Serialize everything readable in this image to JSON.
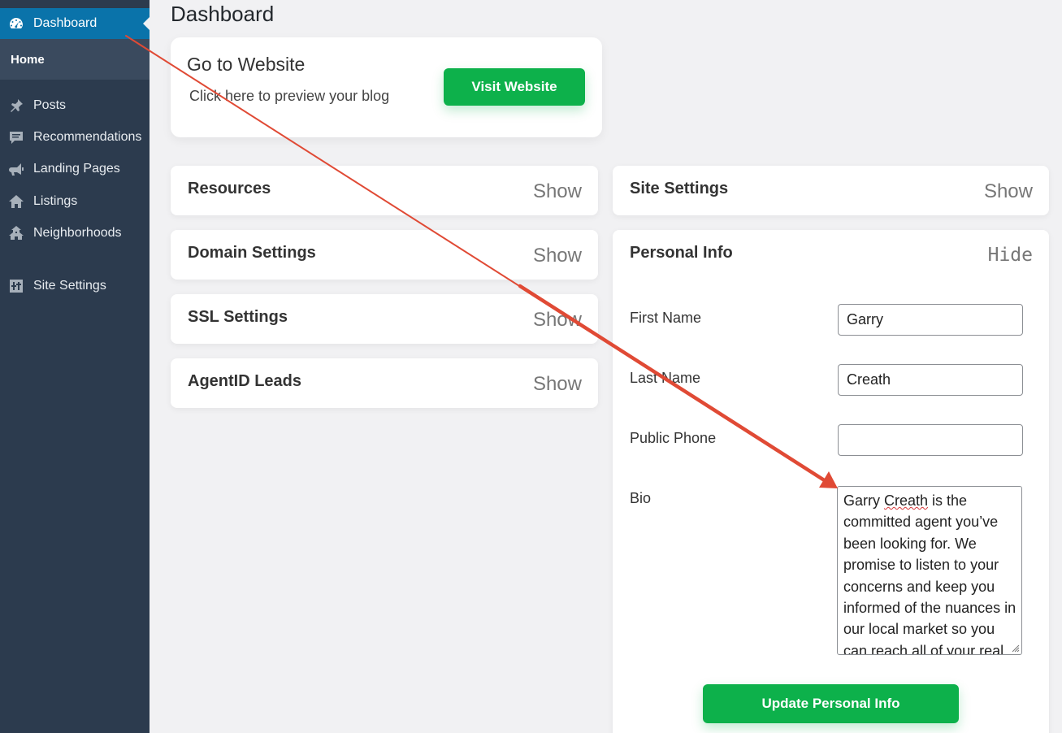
{
  "sidebar": {
    "active": {
      "label": "Dashboard",
      "icon": "dashboard-gauge-icon"
    },
    "submenu": {
      "label": "Home"
    },
    "items": [
      {
        "label": "Posts",
        "icon": "pin-icon"
      },
      {
        "label": "Recommendations",
        "icon": "comment-icon"
      },
      {
        "label": "Landing Pages",
        "icon": "megaphone-icon"
      },
      {
        "label": "Listings",
        "icon": "home-icon"
      },
      {
        "label": "Neighborhoods",
        "icon": "neighborhood-icon"
      },
      {
        "label": "Site Settings",
        "icon": "settings-sliders-icon"
      }
    ]
  },
  "page": {
    "title": "Dashboard"
  },
  "goto": {
    "title": "Go to Website",
    "description": "Click here to preview your blog",
    "button": "Visit Website"
  },
  "sections": {
    "resources": {
      "title": "Resources",
      "toggle": "Show"
    },
    "domain": {
      "title": "Domain Settings",
      "toggle": "Show"
    },
    "ssl": {
      "title": "SSL Settings",
      "toggle": "Show"
    },
    "agentid": {
      "title": "AgentID Leads",
      "toggle": "Show"
    },
    "site_settings": {
      "title": "Site Settings",
      "toggle": "Show"
    },
    "personal": {
      "title": "Personal Info",
      "toggle": "Hide"
    }
  },
  "personal_form": {
    "first_name": {
      "label": "First Name",
      "value": "Garry"
    },
    "last_name": {
      "label": "Last Name",
      "value": "Creath"
    },
    "phone": {
      "label": "Public Phone",
      "value": ""
    },
    "bio": {
      "label": "Bio",
      "first_word": "Garry ",
      "spell_word": "Creath",
      "value_rest": " is the committed agent you’ve been looking for. We promise to listen to your concerns and keep you informed of the nuances in our local market so you can reach all of your real"
    },
    "submit": "Update Personal Info"
  },
  "colors": {
    "accent_green": "#0db14b",
    "sidebar": "#2c3b4e",
    "active_blue": "#0a73aa",
    "annotation_arrow": "#e04a35"
  }
}
